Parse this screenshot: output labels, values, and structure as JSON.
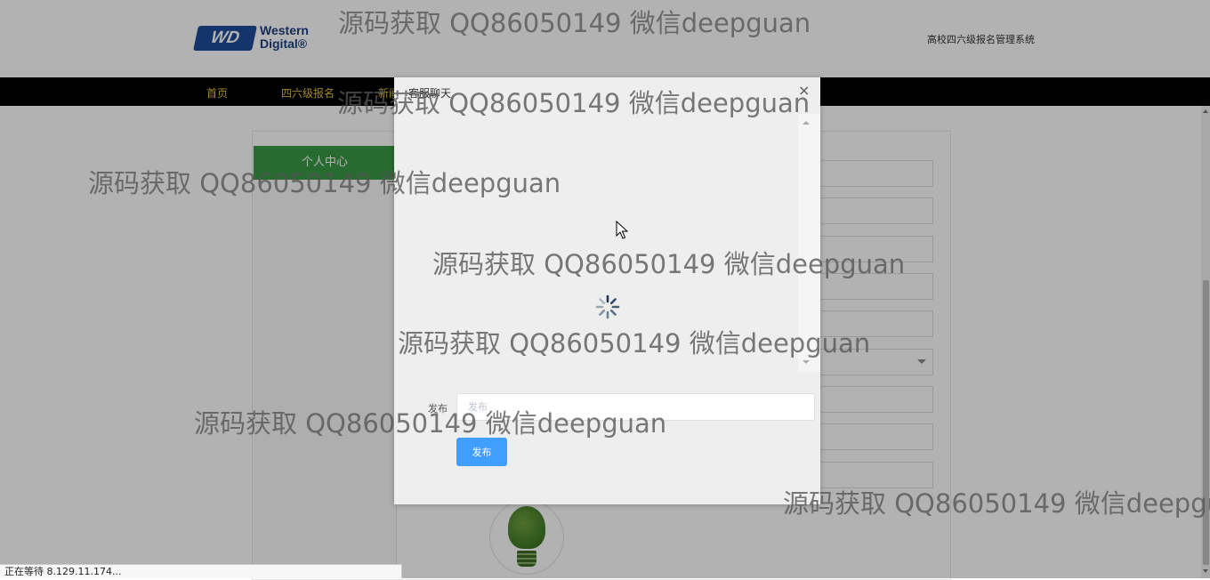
{
  "header": {
    "logo_line1": "Western",
    "logo_line2": "Digital®",
    "logo_badge": "WD",
    "site_title": "高校四六级报名管理系统"
  },
  "nav": {
    "items": [
      {
        "label": "首页"
      },
      {
        "label": "四六级报名"
      },
      {
        "label": "新闻"
      }
    ]
  },
  "sidebar": {
    "heading": "个人中心"
  },
  "modal": {
    "title": "客服聊天",
    "close_label": "×",
    "form_label": "发布",
    "input_value": "",
    "input_placeholder": "发布",
    "publish_button": "发布"
  },
  "status_bar": {
    "text": "正在等待 8.129.11.174..."
  },
  "watermark": {
    "text": "源码获取 QQ86050149 微信deepguan"
  },
  "colors": {
    "nav_background": "#000000",
    "nav_text": "#e8c23e",
    "sidebar_heading": "#3a9a45",
    "primary_button": "#409eff",
    "overlay": "rgba(0,0,0,0.30)"
  }
}
